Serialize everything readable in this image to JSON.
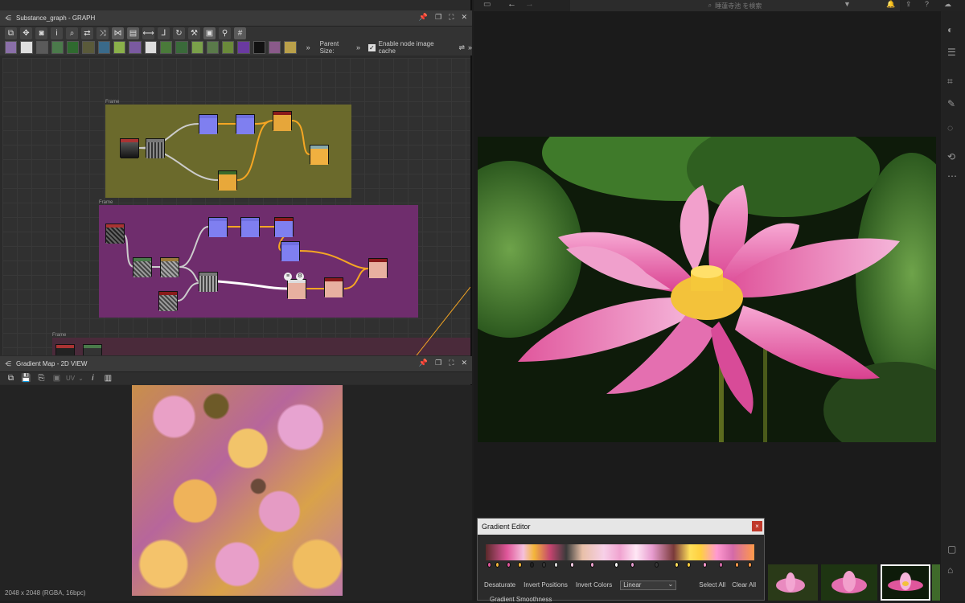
{
  "graph_panel": {
    "title": "Substance_graph - GRAPH",
    "parent_size_label": "Parent Size:",
    "cache_label": "Enable node image cache",
    "more": "»",
    "frame_labels": [
      "Frame",
      "Frame",
      "Frame"
    ]
  },
  "view2d_panel": {
    "title": "Gradient Map - 2D VIEW",
    "uv_label": "UV",
    "status": "2048 x 2048 (RGBA, 16bpc)"
  },
  "photo_app": {
    "search_placeholder": "睡蓮寺池 を検索"
  },
  "gradient_editor": {
    "title": "Gradient Editor",
    "close": "×",
    "actions": [
      "Desaturate",
      "Invert Positions",
      "Invert Colors"
    ],
    "mode": "Linear",
    "right_actions": [
      "Select All",
      "Clear All"
    ],
    "smoothness_label": "Gradient Smoothness"
  },
  "colors": {
    "frame1": "#6b6a2c",
    "frame2": "#6f2d6d",
    "accent_orange": "#f5a623",
    "accent_blue": "#7f7ff0"
  }
}
